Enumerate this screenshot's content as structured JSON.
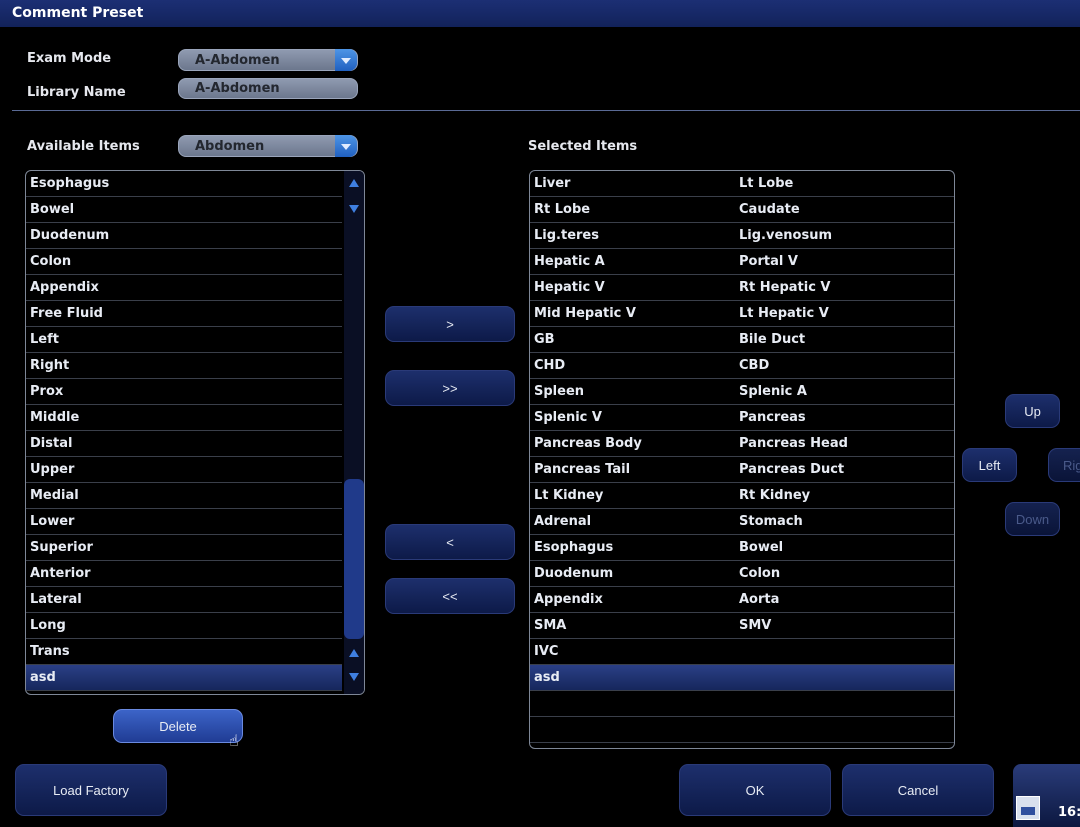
{
  "title": "Comment Preset",
  "exam_mode": {
    "label": "Exam Mode",
    "value": "A-Abdomen"
  },
  "library_name": {
    "label": "Library Name",
    "value": "A-Abdomen"
  },
  "available": {
    "label": "Available Items",
    "category": "Abdomen",
    "items": [
      "Esophagus",
      "Bowel",
      "Duodenum",
      "Colon",
      "Appendix",
      "Free Fluid",
      "Left",
      "Right",
      "Prox",
      "Middle",
      "Distal",
      "Upper",
      "Medial",
      "Lower",
      "Superior",
      "Anterior",
      "Lateral",
      "Long",
      "Trans",
      "asd"
    ],
    "selected_index": 19
  },
  "selected": {
    "label": "Selected Items",
    "rows": [
      [
        "Liver",
        "Lt Lobe"
      ],
      [
        "Rt Lobe",
        "Caudate"
      ],
      [
        "Lig.teres",
        "Lig.venosum"
      ],
      [
        "Hepatic A",
        "Portal V"
      ],
      [
        "Hepatic V",
        "Rt Hepatic V"
      ],
      [
        "Mid Hepatic V",
        "Lt Hepatic V"
      ],
      [
        "GB",
        "Bile Duct"
      ],
      [
        "CHD",
        "CBD"
      ],
      [
        "Spleen",
        "Splenic A"
      ],
      [
        "Splenic V",
        "Pancreas"
      ],
      [
        "Pancreas Body",
        "Pancreas Head"
      ],
      [
        "Pancreas Tail",
        "Pancreas Duct"
      ],
      [
        "Lt Kidney",
        "Rt Kidney"
      ],
      [
        "Adrenal",
        "Stomach"
      ],
      [
        "Esophagus",
        "Bowel"
      ],
      [
        "Duodenum",
        "Colon"
      ],
      [
        "Appendix",
        "Aorta"
      ],
      [
        "SMA",
        "SMV"
      ],
      [
        "IVC",
        ""
      ],
      [
        "asd",
        ""
      ],
      [
        "",
        ""
      ],
      [
        "",
        ""
      ]
    ],
    "selected_index": 19
  },
  "transfer": {
    "add": ">",
    "add_all": ">>",
    "remove": "<",
    "remove_all": "<<"
  },
  "move": {
    "up": "Up",
    "left": "Left",
    "right": "Rig",
    "down": "Down"
  },
  "buttons": {
    "delete": "Delete",
    "load_factory": "Load Factory",
    "ok": "OK",
    "cancel": "Cancel"
  },
  "clock": "16:"
}
